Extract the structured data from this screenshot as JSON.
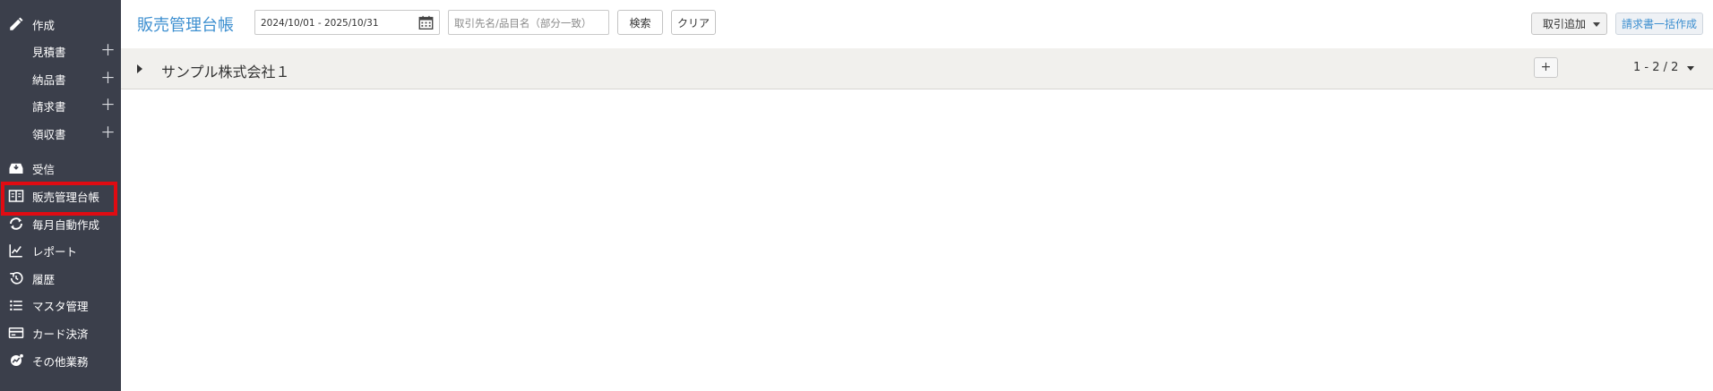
{
  "sidebar": {
    "create": {
      "label": "作成",
      "icon": "pencil-icon"
    },
    "sub_items": [
      {
        "label": "見積書",
        "add": "＋"
      },
      {
        "label": "納品書",
        "add": "＋"
      },
      {
        "label": "請求書",
        "add": "＋"
      },
      {
        "label": "領収書",
        "add": "＋"
      }
    ],
    "items": [
      {
        "label": "受信",
        "icon": "inbox-icon"
      },
      {
        "label": "販売管理台帳",
        "icon": "ledger-book-icon",
        "highlighted": true
      },
      {
        "label": "毎月自動作成",
        "icon": "refresh-icon"
      },
      {
        "label": "レポート",
        "icon": "line-chart-icon"
      },
      {
        "label": "履歴",
        "icon": "history-icon"
      },
      {
        "label": "マスタ管理",
        "icon": "list-icon"
      },
      {
        "label": "カード決済",
        "icon": "credit-card-icon"
      },
      {
        "label": "その他業務",
        "icon": "gear-chart-icon"
      }
    ],
    "highlight_color": "#e00b12"
  },
  "toolbar": {
    "title": "販売管理台帳",
    "date_range": "2024/10/01 - 2025/10/31",
    "search_placeholder": "取引先名/品目名（部分一致）",
    "search_button": "検索",
    "clear_button": "クリア",
    "add_transaction_button": "取引追加",
    "bulk_invoice_button": "請求書一括作成"
  },
  "group": {
    "name": "サンプル株式会社１",
    "add": "+",
    "paging": "1 - 2 / 2"
  },
  "colors": {
    "sidebar_bg": "#3b3f4b",
    "accent": "#3d8fd0",
    "group_bg": "#f1f0ed"
  }
}
